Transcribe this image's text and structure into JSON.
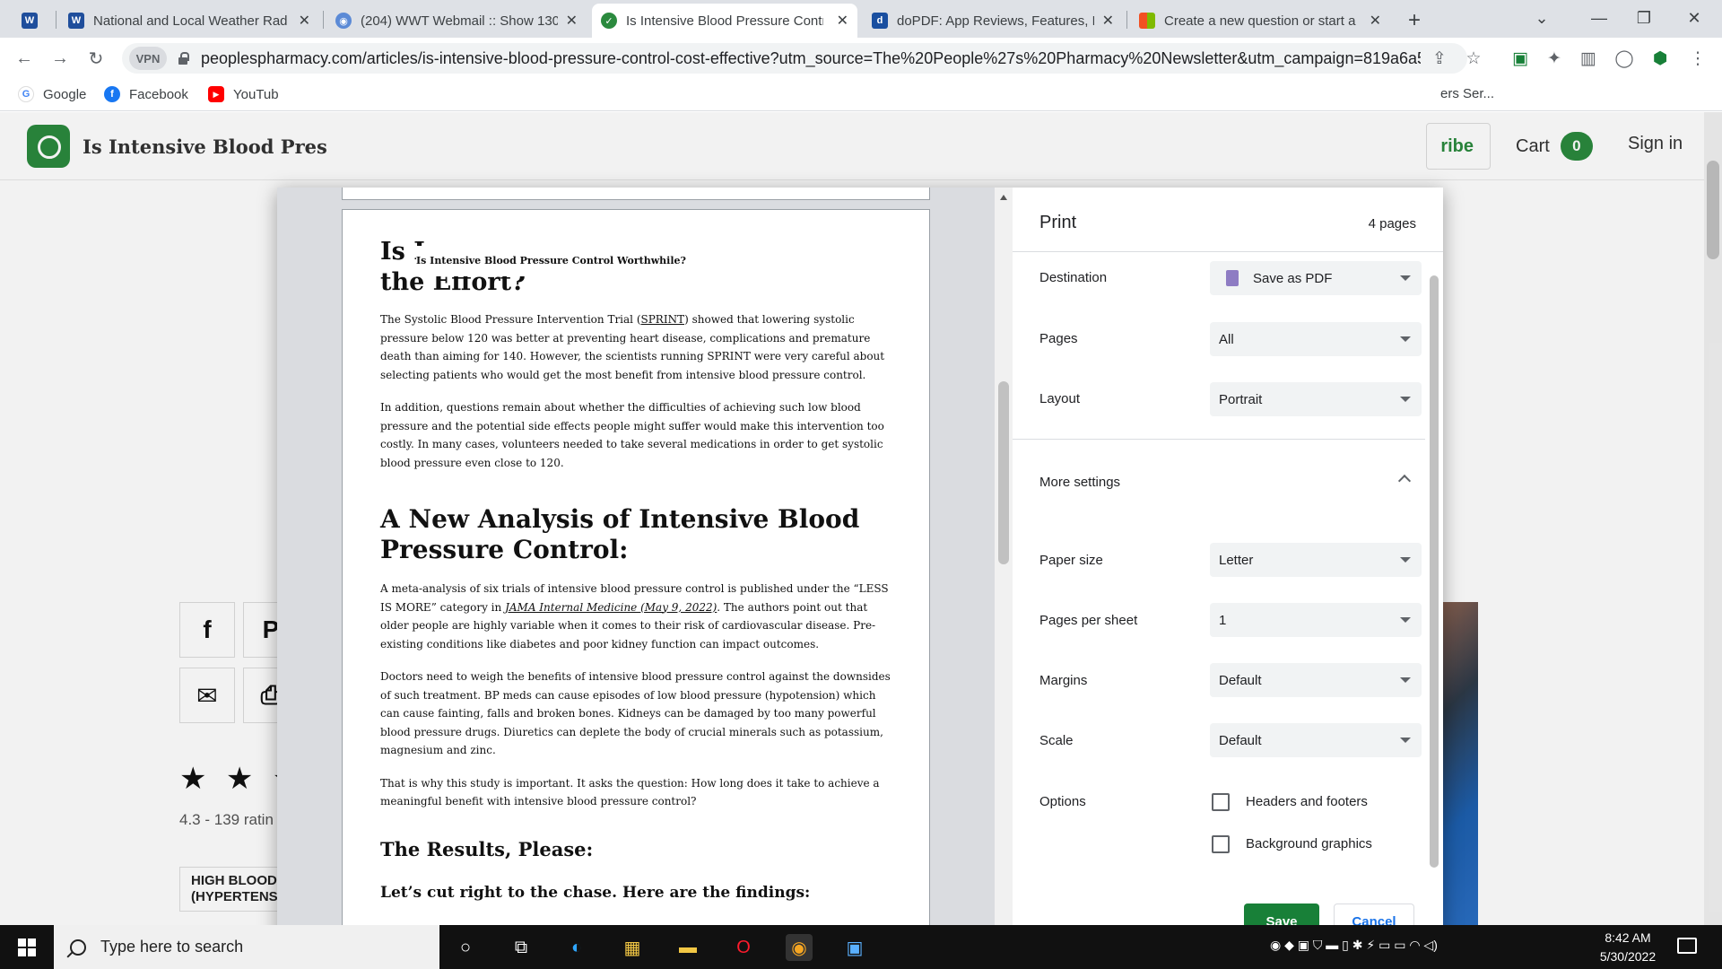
{
  "browser": {
    "tabs": [
      {
        "title": "",
        "favicon_color": "#1f4e9c"
      },
      {
        "title": "National and Local Weather Rad",
        "favicon_color": "#1f4e9c"
      },
      {
        "title": "(204) WWT Webmail :: Show 130",
        "favicon_color": "#5b8ad6"
      },
      {
        "title": "Is Intensive Blood Pressure Contr",
        "favicon_color": "#2b8a3e"
      },
      {
        "title": "doPDF: App Reviews, Features, Pr",
        "favicon_color": "#1a4fa0"
      },
      {
        "title": "Create a new question or start a",
        "favicon_color": "#f25022"
      }
    ],
    "new_tab": "+",
    "url": "peoplespharmacy.com/articles/is-intensive-blood-pressure-control-cost-effective?utm_source=The%20People%27s%20Pharmacy%20Newsletter&utm_campaign=819a6a5e0...",
    "vpn": "VPN",
    "bookmarks": [
      {
        "label": "Google",
        "color": "#4285f4",
        "glyph": "G"
      },
      {
        "label": "Facebook",
        "color": "#1877f2",
        "glyph": "f"
      },
      {
        "label": "YouTub",
        "color": "#ff0000",
        "glyph": "▶"
      }
    ],
    "bookmark_overflow": "ers Ser..."
  },
  "site": {
    "title": "Is Intensive Blood Pres",
    "subscribe_partial": "ribe",
    "cart_label": "Cart",
    "cart_count": "0",
    "signin": "Sign in",
    "stars": "★ ★ ★",
    "rating": "4.3 - 139 ratin",
    "tag": "HIGH BLOOD PRESSURE (HYPERTENSION)"
  },
  "print": {
    "title": "Print",
    "pages_count": "4 pages",
    "destination_label": "Destination",
    "destination_value": "Save as PDF",
    "pages_label": "Pages",
    "pages_value": "All",
    "layout_label": "Layout",
    "layout_value": "Portrait",
    "more_settings": "More settings",
    "paper_label": "Paper size",
    "paper_value": "Letter",
    "pps_label": "Pages per sheet",
    "pps_value": "1",
    "margins_label": "Margins",
    "margins_value": "Default",
    "scale_label": "Scale",
    "scale_value": "Default",
    "options_label": "Options",
    "opt_headers": "Headers and footers",
    "opt_background": "Background graphics",
    "save": "Save",
    "cancel": "Cancel"
  },
  "preview": {
    "heading_a": "Is I",
    "heading_b": "the Effort?",
    "running_header": "Is Intensive Blood Pressure Control Worthwhile?",
    "p1_a": "The Systolic Blood Pressure Intervention Trial (",
    "p1_link": "SPRINT",
    "p1_b": ") showed that lowering systolic pressure below 120 was better at preventing heart disease, complications and premature death than aiming for 140. However, the scientists running SPRINT were very careful about selecting patients who would get the most benefit from intensive blood pressure control.",
    "p2": "In addition, questions remain about whether the difficulties of achieving such low blood pressure and the potential side effects people might suffer would make this intervention too costly. In many cases, volunteers needed to take several medications in order to get systolic blood pressure even close to 120.",
    "h2": "A New Analysis of Intensive Blood Pressure Control:",
    "p3_a": "A meta-analysis of six trials of intensive blood pressure control is published under the “LESS IS MORE” category in ",
    "p3_link": "JAMA Internal Medicine (May 9, 2022)",
    "p3_b": ". The authors point out that older people are highly variable when it comes to their risk of cardiovascular disease. Pre-existing conditions like diabetes and poor kidney function can impact outcomes.",
    "p4": "Doctors need to weigh the benefits of intensive blood pressure control against the downsides of such treatment. BP meds can cause episodes of low blood pressure (hypotension) which can cause fainting, falls and broken bones. Kidneys can be damaged by too many powerful blood pressure drugs. Diuretics can deplete the body of crucial minerals such as potassium, magnesium and zinc.",
    "p5": "That is why this study is important. It asks the question: How long does it take to achieve a meaningful benefit with intensive blood pressure control?",
    "h3": "The Results, Please:",
    "h4": "Let’s cut right to the chase. Here are the findings:"
  },
  "taskbar": {
    "search_placeholder": "Type here to search",
    "time": "8:42 AM",
    "date": "5/30/2022"
  }
}
